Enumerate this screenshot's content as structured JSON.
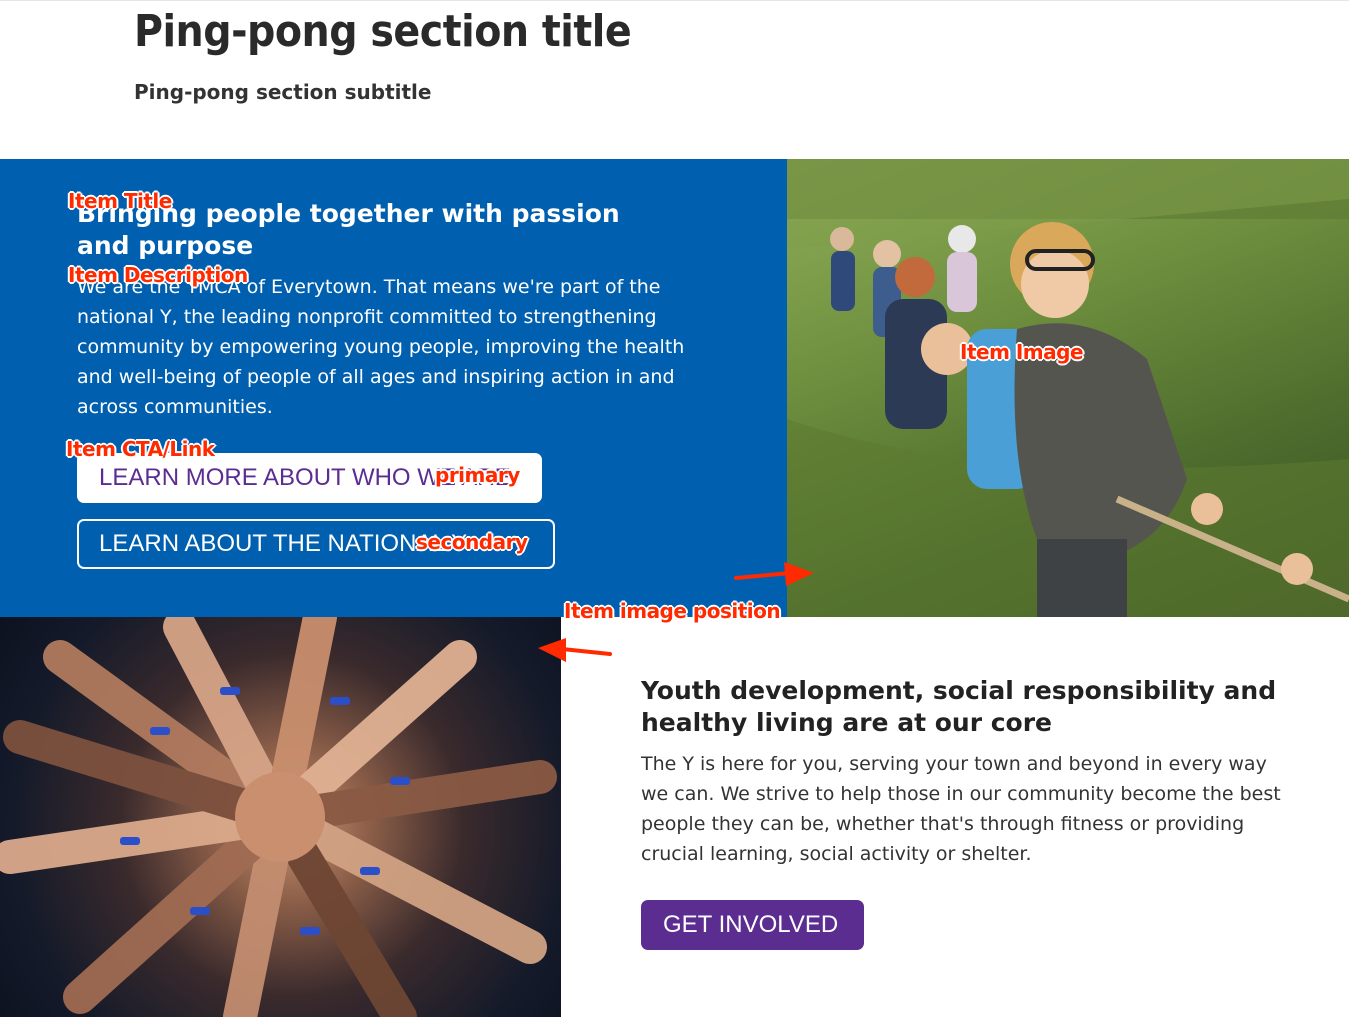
{
  "section": {
    "title": "Ping-pong section title",
    "subtitle": "Ping-pong section subtitle"
  },
  "items": [
    {
      "title": "Bringing people together with passion and purpose",
      "description": "We are the YMCA of Everytown. That means we're part of the national Y, the leading nonprofit committed to strengthening community by empowering young people, improving the health and well-being of people of all ages and inspiring action in and across communities.",
      "primary_cta": "LEARN MORE ABOUT WHO WE ARE",
      "secondary_cta": "LEARN ABOUT THE NATIONAL Y"
    },
    {
      "title": "Youth development, social responsibility and healthy living are at our core",
      "description": "The Y is here for you, serving your town and beyond in every way we can. We strive to help those in our community become the best people they can be, whether that's through fitness or providing crucial learning, social activity or shelter.",
      "primary_cta": "GET INVOLVED"
    }
  ],
  "annotations": {
    "item_title": "Item Title",
    "item_description": "Item Description",
    "item_cta": "Item CTA/Link",
    "primary": "primary",
    "secondary": "secondary",
    "item_image": "Item Image",
    "item_image_position": "Item image position"
  },
  "colors": {
    "brand_blue": "#0060af",
    "brand_purple": "#5c2d91",
    "annotation_red": "#ff2a00"
  }
}
